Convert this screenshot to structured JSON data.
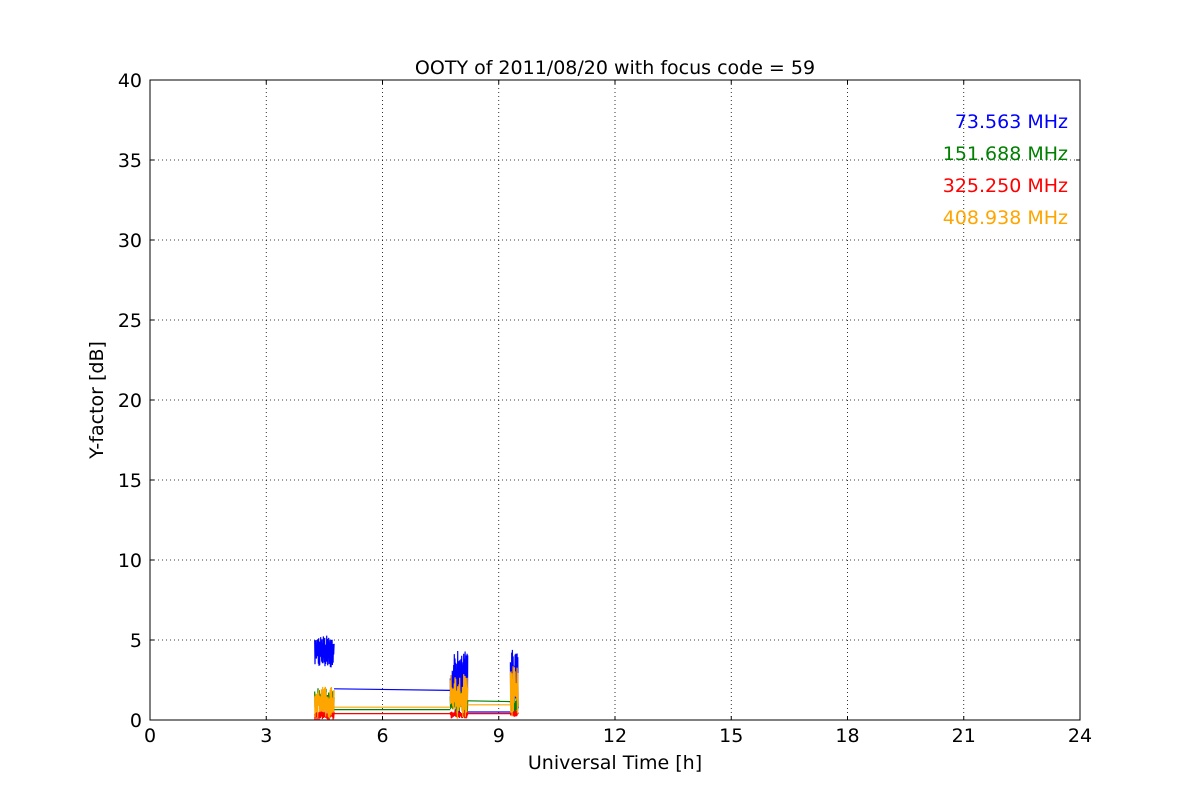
{
  "chart_data": {
    "type": "line",
    "title": "OOTY of 2011/08/20 with focus code = 59",
    "xlabel": "Universal Time [h]",
    "ylabel": "Y-factor [dB]",
    "xlim": [
      0,
      24
    ],
    "ylim": [
      0,
      40
    ],
    "x_ticks": [
      "0",
      "3",
      "6",
      "9",
      "12",
      "15",
      "18",
      "21",
      "24"
    ],
    "y_ticks": [
      "0",
      "5",
      "10",
      "15",
      "20",
      "25",
      "30",
      "35",
      "40"
    ],
    "grid": true,
    "legend_position": "top-right",
    "series": [
      {
        "name": "73.563 MHz",
        "color": "#0000ff",
        "segments": [
          {
            "x_start": 4.25,
            "x_end": 4.75,
            "y_min": 3.2,
            "y_max": 5.3
          },
          {
            "x_start": 7.75,
            "x_end": 8.2,
            "y_min": 0.3,
            "y_max": 4.4
          },
          {
            "x_start": 9.3,
            "x_end": 9.5,
            "y_min": 0.3,
            "y_max": 4.8
          }
        ],
        "bridges": [
          {
            "x": [
              4.75,
              7.75
            ],
            "y": [
              1.95,
              1.85
            ]
          },
          {
            "x": [
              8.2,
              9.3
            ],
            "y": [
              0.5,
              0.5
            ]
          }
        ]
      },
      {
        "name": "151.688 MHz",
        "color": "#008000",
        "segments": [
          {
            "x_start": 4.25,
            "x_end": 4.75,
            "y_min": 0.5,
            "y_max": 2.0
          },
          {
            "x_start": 7.75,
            "x_end": 8.2,
            "y_min": 0.4,
            "y_max": 1.8
          },
          {
            "x_start": 9.3,
            "x_end": 9.5,
            "y_min": 0.4,
            "y_max": 1.6
          }
        ],
        "bridges": [
          {
            "x": [
              4.75,
              7.75
            ],
            "y": [
              0.65,
              0.65
            ]
          },
          {
            "x": [
              8.2,
              9.3
            ],
            "y": [
              1.2,
              1.15
            ]
          }
        ]
      },
      {
        "name": "325.250 MHz",
        "color": "#ff0000",
        "segments": [
          {
            "x_start": 4.25,
            "x_end": 4.75,
            "y_min": 0.0,
            "y_max": 0.6
          },
          {
            "x_start": 7.75,
            "x_end": 8.2,
            "y_min": 0.1,
            "y_max": 0.6
          },
          {
            "x_start": 9.3,
            "x_end": 9.5,
            "y_min": 0.2,
            "y_max": 0.6
          }
        ],
        "bridges": [
          {
            "x": [
              4.75,
              7.75
            ],
            "y": [
              0.4,
              0.4
            ]
          },
          {
            "x": [
              8.2,
              9.3
            ],
            "y": [
              0.4,
              0.4
            ]
          }
        ]
      },
      {
        "name": "408.938 MHz",
        "color": "#ffa500",
        "segments": [
          {
            "x_start": 4.25,
            "x_end": 4.75,
            "y_min": 0.1,
            "y_max": 2.1
          },
          {
            "x_start": 7.75,
            "x_end": 8.2,
            "y_min": 0.1,
            "y_max": 2.9
          },
          {
            "x_start": 9.3,
            "x_end": 9.5,
            "y_min": 0.2,
            "y_max": 3.6
          }
        ],
        "bridges": [
          {
            "x": [
              4.75,
              7.75
            ],
            "y": [
              0.8,
              0.8
            ]
          },
          {
            "x": [
              8.2,
              9.3
            ],
            "y": [
              0.95,
              0.95
            ]
          }
        ]
      }
    ]
  }
}
